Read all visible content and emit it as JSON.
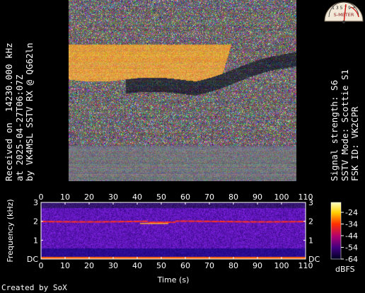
{
  "left_caption": {
    "line1": "Received on  14230.000 kHz",
    "line2": "at 2025-04-27T06:07Z",
    "line3": "by VK4MSL SSTV RX @ QG62ln"
  },
  "right_caption": {
    "line1": "Signal strength: S6",
    "line2": "SSTV Mode: Scottie S1",
    "line3": "FSK ID: VK2CPR"
  },
  "meter": {
    "label": "S-METER",
    "scale": "1 3 5 7 9 +",
    "level": "S6"
  },
  "colors": {
    "background": "#000000",
    "text": "#ffffff",
    "spectrogram_base": "#3a0a6a",
    "signal_band": "#ff2a10",
    "dc_line": "#ff6a00"
  },
  "spectrogram": {
    "ylabel": "Frequency (kHz)",
    "xlabel": "Time (s)",
    "colorbar_label": "dBFS",
    "x_ticks": [
      "0",
      "10",
      "20",
      "30",
      "40",
      "50",
      "60",
      "70",
      "80",
      "90",
      "100",
      "110"
    ],
    "y_ticks": [
      "DC",
      "1",
      "2",
      "3"
    ],
    "colorbar_ticks": [
      "-24",
      "-34",
      "-44",
      "-54",
      "-64"
    ]
  },
  "chart_data": {
    "type": "heatmap",
    "xlabel": "Time (s)",
    "ylabel": "Frequency (kHz)",
    "xlim": [
      0,
      110
    ],
    "ylim": [
      0,
      3
    ],
    "colorbar": {
      "label": "dBFS",
      "range": [
        -64,
        -24
      ]
    }
  },
  "credit": "Created by SoX"
}
